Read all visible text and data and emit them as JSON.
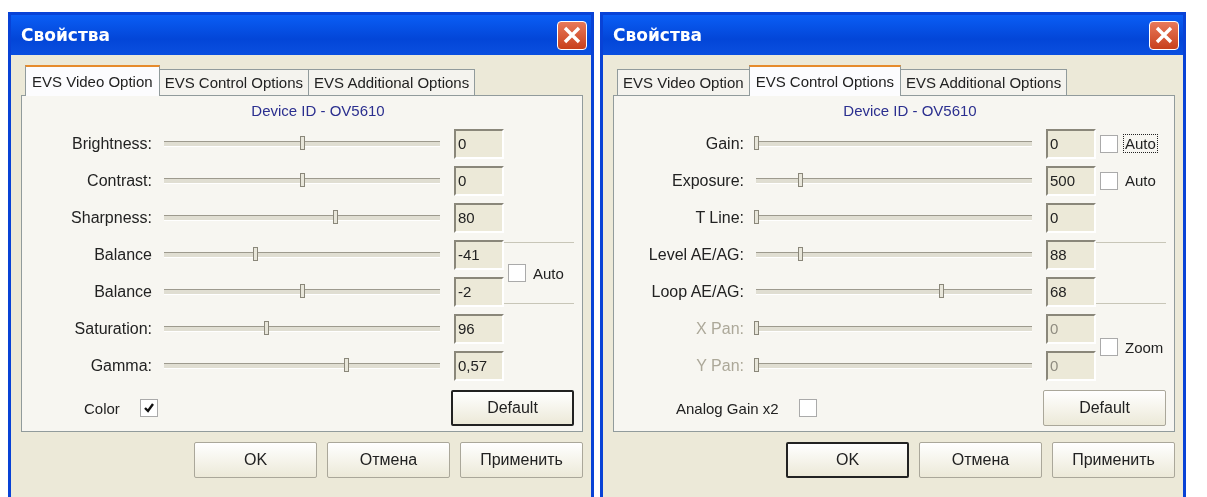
{
  "dialogs": [
    {
      "title": "Свойства",
      "tabs": [
        {
          "label": "EVS Video Option",
          "selected": true
        },
        {
          "label": "EVS Control Options",
          "selected": false
        },
        {
          "label": "EVS Additional Options",
          "selected": false
        }
      ],
      "device_id": "Device ID - OV5610",
      "groups": [
        {
          "sliders": [
            {
              "label": "Brightness:",
              "level": 0.5,
              "value": "0",
              "disabled": false
            }
          ]
        },
        {
          "sliders": [
            {
              "label": "Contrast:",
              "level": 0.5,
              "value": "0",
              "disabled": false
            }
          ]
        },
        {
          "sliders": [
            {
              "label": "Sharpness:",
              "level": 0.62,
              "value": "80",
              "disabled": false
            }
          ]
        },
        {
          "framed": true,
          "sliders": [
            {
              "label": "Balance",
              "level": 0.33,
              "value": "-41",
              "disabled": false
            },
            {
              "label": "Balance",
              "level": 0.5,
              "value": "-2",
              "disabled": false
            }
          ],
          "checkbox": {
            "label": "Auto",
            "checked": false,
            "focused": false
          }
        },
        {
          "sliders": [
            {
              "label": "Saturation:",
              "level": 0.37,
              "value": "96",
              "disabled": false
            }
          ]
        },
        {
          "sliders": [
            {
              "label": "Gamma:",
              "level": 0.66,
              "value": "0,57",
              "disabled": false
            }
          ]
        }
      ],
      "bottom_checkbox": {
        "label": "Color",
        "checked": true
      },
      "default_button": {
        "label": "Default",
        "focused": true
      },
      "buttons": [
        {
          "label": "OK",
          "focused": false
        },
        {
          "label": "Отмена",
          "focused": false
        },
        {
          "label": "Применить",
          "focused": false
        }
      ]
    },
    {
      "title": "Свойства",
      "tabs": [
        {
          "label": "EVS Video Option",
          "selected": false
        },
        {
          "label": "EVS Control Options",
          "selected": true
        },
        {
          "label": "EVS Additional Options",
          "selected": false
        }
      ],
      "device_id": "Device ID - OV5610",
      "groups": [
        {
          "sliders": [
            {
              "label": "Gain:",
              "level": 0,
              "value": "0",
              "disabled": false
            }
          ],
          "checkbox": {
            "label": "Auto",
            "checked": false,
            "focused": true
          }
        },
        {
          "sliders": [
            {
              "label": "Exposure:",
              "level": 0.16,
              "value": "500",
              "disabled": false
            }
          ],
          "checkbox": {
            "label": "Auto",
            "checked": false,
            "focused": false
          }
        },
        {
          "sliders": [
            {
              "label": "T Line:",
              "level": 0,
              "value": "0",
              "disabled": false
            }
          ]
        },
        {
          "framed": true,
          "sliders": [
            {
              "label": "Level AE/AG:",
              "level": 0.16,
              "value": "88",
              "disabled": false
            },
            {
              "label": "Loop AE/AG:",
              "level": 0.67,
              "value": "68",
              "disabled": false
            }
          ]
        },
        {
          "sliders": [
            {
              "label": "X Pan:",
              "level": 0,
              "value": "0",
              "disabled": true
            },
            {
              "label": "Y Pan:",
              "level": 0,
              "value": "0",
              "disabled": true
            }
          ],
          "checkbox": {
            "label": "Zoom",
            "checked": false,
            "focused": false
          }
        }
      ],
      "bottom_checkbox": {
        "label": "Analog Gain x2",
        "checked": false
      },
      "default_button": {
        "label": "Default",
        "focused": false
      },
      "buttons": [
        {
          "label": "OK",
          "focused": true
        },
        {
          "label": "Отмена",
          "focused": false
        },
        {
          "label": "Применить",
          "focused": false
        }
      ]
    }
  ]
}
